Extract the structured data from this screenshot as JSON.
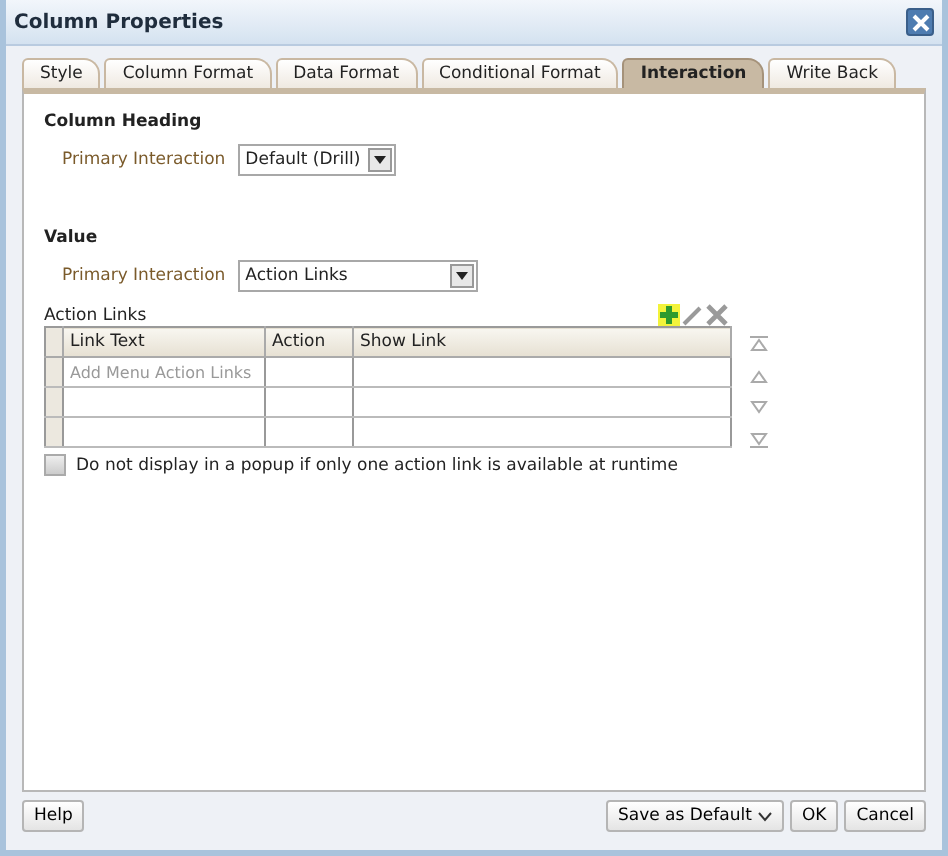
{
  "window": {
    "title": "Column Properties"
  },
  "tabs": [
    {
      "label": "Style",
      "selected": false
    },
    {
      "label": "Column Format",
      "selected": false
    },
    {
      "label": "Data Format",
      "selected": false
    },
    {
      "label": "Conditional Format",
      "selected": false
    },
    {
      "label": "Interaction",
      "selected": true
    },
    {
      "label": "Write Back",
      "selected": false
    }
  ],
  "column_heading": {
    "title": "Column Heading",
    "primary_interaction": {
      "label": "Primary Interaction",
      "value": "Default (Drill)"
    }
  },
  "value": {
    "title": "Value",
    "primary_interaction": {
      "label": "Primary Interaction",
      "value": "Action Links"
    },
    "action_links": {
      "label": "Action Links",
      "columns": [
        "Link Text",
        "Action",
        "Show Link"
      ],
      "rows": [
        {
          "kind": "hint",
          "link_text": "Add Menu Action Links"
        },
        {
          "kind": "empty"
        },
        {
          "kind": "empty"
        }
      ]
    },
    "popup_option": {
      "label": "Do not display in a popup if only one action link is available at runtime",
      "checked": false
    }
  },
  "buttons": {
    "help": "Help",
    "right": [
      {
        "label": "Save as Default",
        "menu": true
      },
      {
        "label": "OK",
        "menu": false
      },
      {
        "label": "Cancel",
        "menu": false
      }
    ]
  }
}
